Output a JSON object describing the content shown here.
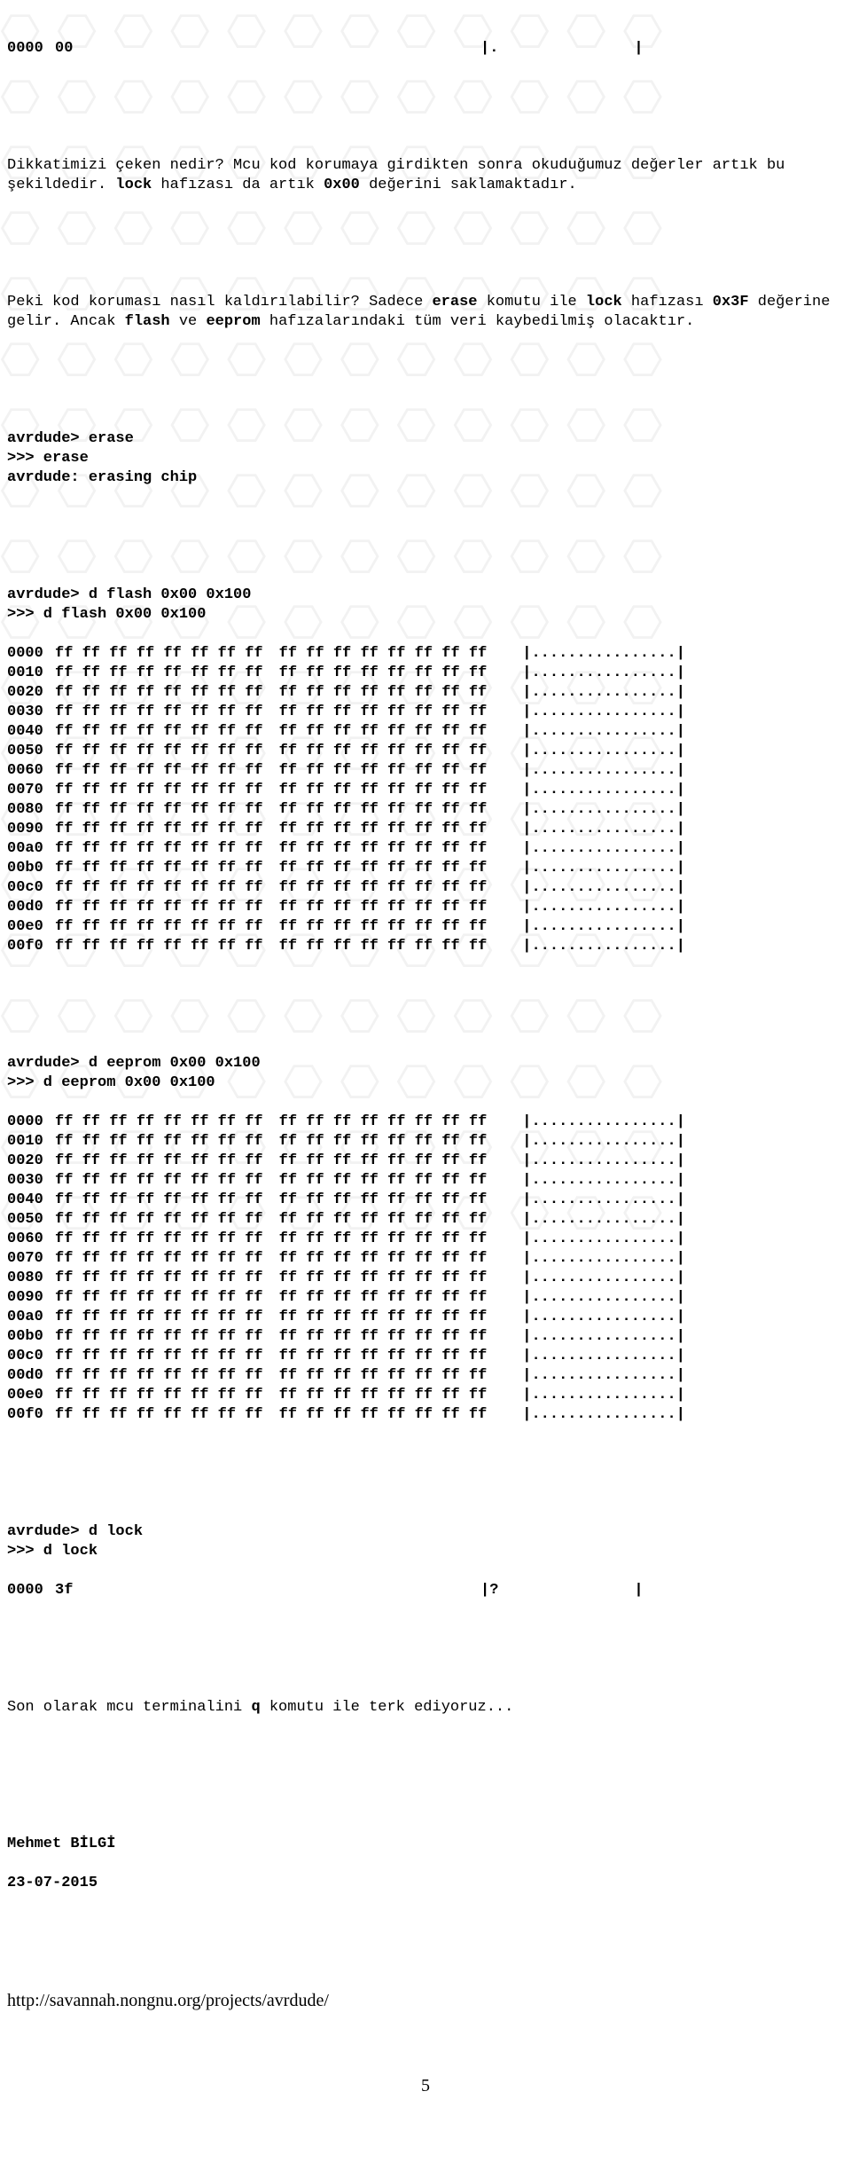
{
  "top_dump": {
    "addr": "0000",
    "hex": "00",
    "ascii": "."
  },
  "para1_pre": "Dikkatimizi çeken nedir?\nMcu kod korumaya girdikten sonra okuduğumuz değerler artık bu şekildedir. ",
  "para1_b1": "lock",
  "para1_mid": " hafızası da artık ",
  "para1_b2": "0x00",
  "para1_end": " değerini saklamaktadır.",
  "para2_pre": "Peki kod koruması nasıl kaldırılabilir?\nSadece ",
  "para2_b1": "erase",
  "para2_m1": " komutu ile ",
  "para2_b2": "lock",
  "para2_m2": " hafızası ",
  "para2_b3": "0x3F",
  "para2_m3": " değerine gelir. Ancak ",
  "para2_b4": "flash",
  "para2_m4": " ve ",
  "para2_b5": "eeprom",
  "para2_end": " hafızalarındaki tüm veri kaybedilmiş olacaktır.",
  "erase_block": "avrdude> erase\n>>> erase\navrdude: erasing chip",
  "flash_header": "avrdude> d flash 0x00 0x100\n>>> d flash 0x00 0x100",
  "flash_rows": [
    "0000",
    "0010",
    "0020",
    "0030",
    "0040",
    "0050",
    "0060",
    "0070",
    "0080",
    "0090",
    "00a0",
    "00b0",
    "00c0",
    "00d0",
    "00e0",
    "00f0"
  ],
  "ff_group": "ff ff ff ff ff ff ff ff",
  "dots_ascii": "|................|",
  "eeprom_header": "avrdude> d eeprom 0x00 0x100\n>>> d eeprom 0x00 0x100",
  "eeprom_rows": [
    "0000",
    "0010",
    "0020",
    "0030",
    "0040",
    "0050",
    "0060",
    "0070",
    "0080",
    "0090",
    "00a0",
    "00b0",
    "00c0",
    "00d0",
    "00e0",
    "00f0"
  ],
  "lock_block_hdr": "avrdude> d lock\n>>> d lock",
  "lock_addr": "0000",
  "lock_hex": "3f",
  "lock_ascii": "|?               |",
  "para3_pre": "Son olarak mcu terminalini ",
  "para3_b1": "q",
  "para3_end": " komutu ile terk ediyoruz...",
  "author": "Mehmet BİLGİ",
  "date": "23-07-2015",
  "url": "http://savannah.nongnu.org/projects/avrdude/",
  "page_number": "5",
  "wm_glyph": "⎔  ⎔  ⎔  ⎔  ⎔  ⎔  ⎔  ⎔  ⎔  ⎔  ⎔  ⎔"
}
